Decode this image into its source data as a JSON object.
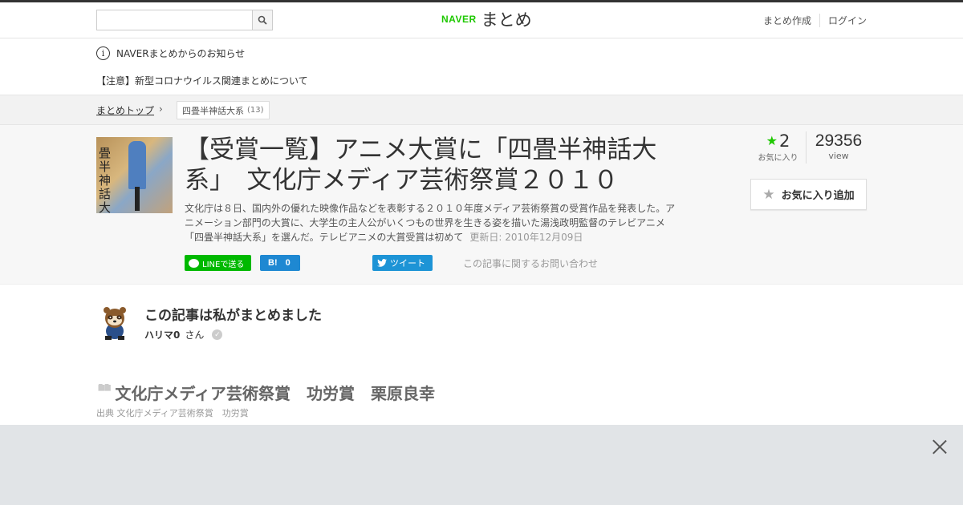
{
  "header": {
    "search_placeholder": "",
    "logo_naver": "NAVER",
    "logo_matome": "まとめ",
    "links": [
      "まとめ作成",
      "ログイン"
    ]
  },
  "notice": {
    "title": "NAVERまとめからのお知らせ",
    "link": "【注意】新型コロナウイルス関連まとめについて"
  },
  "breadcrumb": {
    "home": "まとめトップ",
    "tag": "四畳半神話大系",
    "tag_count": "(13)"
  },
  "article": {
    "title": "【受賞一覧】アニメ大賞に「四畳半神話大系」　文化庁メディア芸術祭賞２０１０",
    "description": "文化庁は８日、国内外の優れた映像作品などを表彰する２０１０年度メディア芸術祭賞の受賞作品を発表した。アニメーション部門の大賞に、大学生の主人公がいくつもの世界を生きる姿を描いた湯浅政明監督のテレビアニメ「四畳半神話大系」を選んだ。テレビアニメの大賞受賞は初めて",
    "updated": "更新日: 2010年12月09日",
    "thumb_text": "畳半神話大"
  },
  "share": {
    "line_label": "LINEで送る",
    "hatena_icon": "B!",
    "hatena_count": "0",
    "tweet_label": "ツイート",
    "contact": "この記事に関するお問い合わせ"
  },
  "stats": {
    "favorites": "2",
    "favorites_label": "お気に入り",
    "views": "29356",
    "views_label": "view",
    "fav_button": "お気に入り追加"
  },
  "author": {
    "heading": "この記事は私がまとめました",
    "name": "ハリマ0",
    "suffix": "さん"
  },
  "quote": {
    "title": "文化庁メディア芸術祭賞　功労賞　栗原良幸",
    "source": "出典  文化庁メディア芸術祭賞　功労賞"
  },
  "colors": {
    "naver_green": "#1ec800",
    "line_green": "#00b900",
    "hatena_blue": "#1e88d2",
    "twitter_blue": "#1d94d6",
    "overlay_gray": "#e1e4e7"
  }
}
